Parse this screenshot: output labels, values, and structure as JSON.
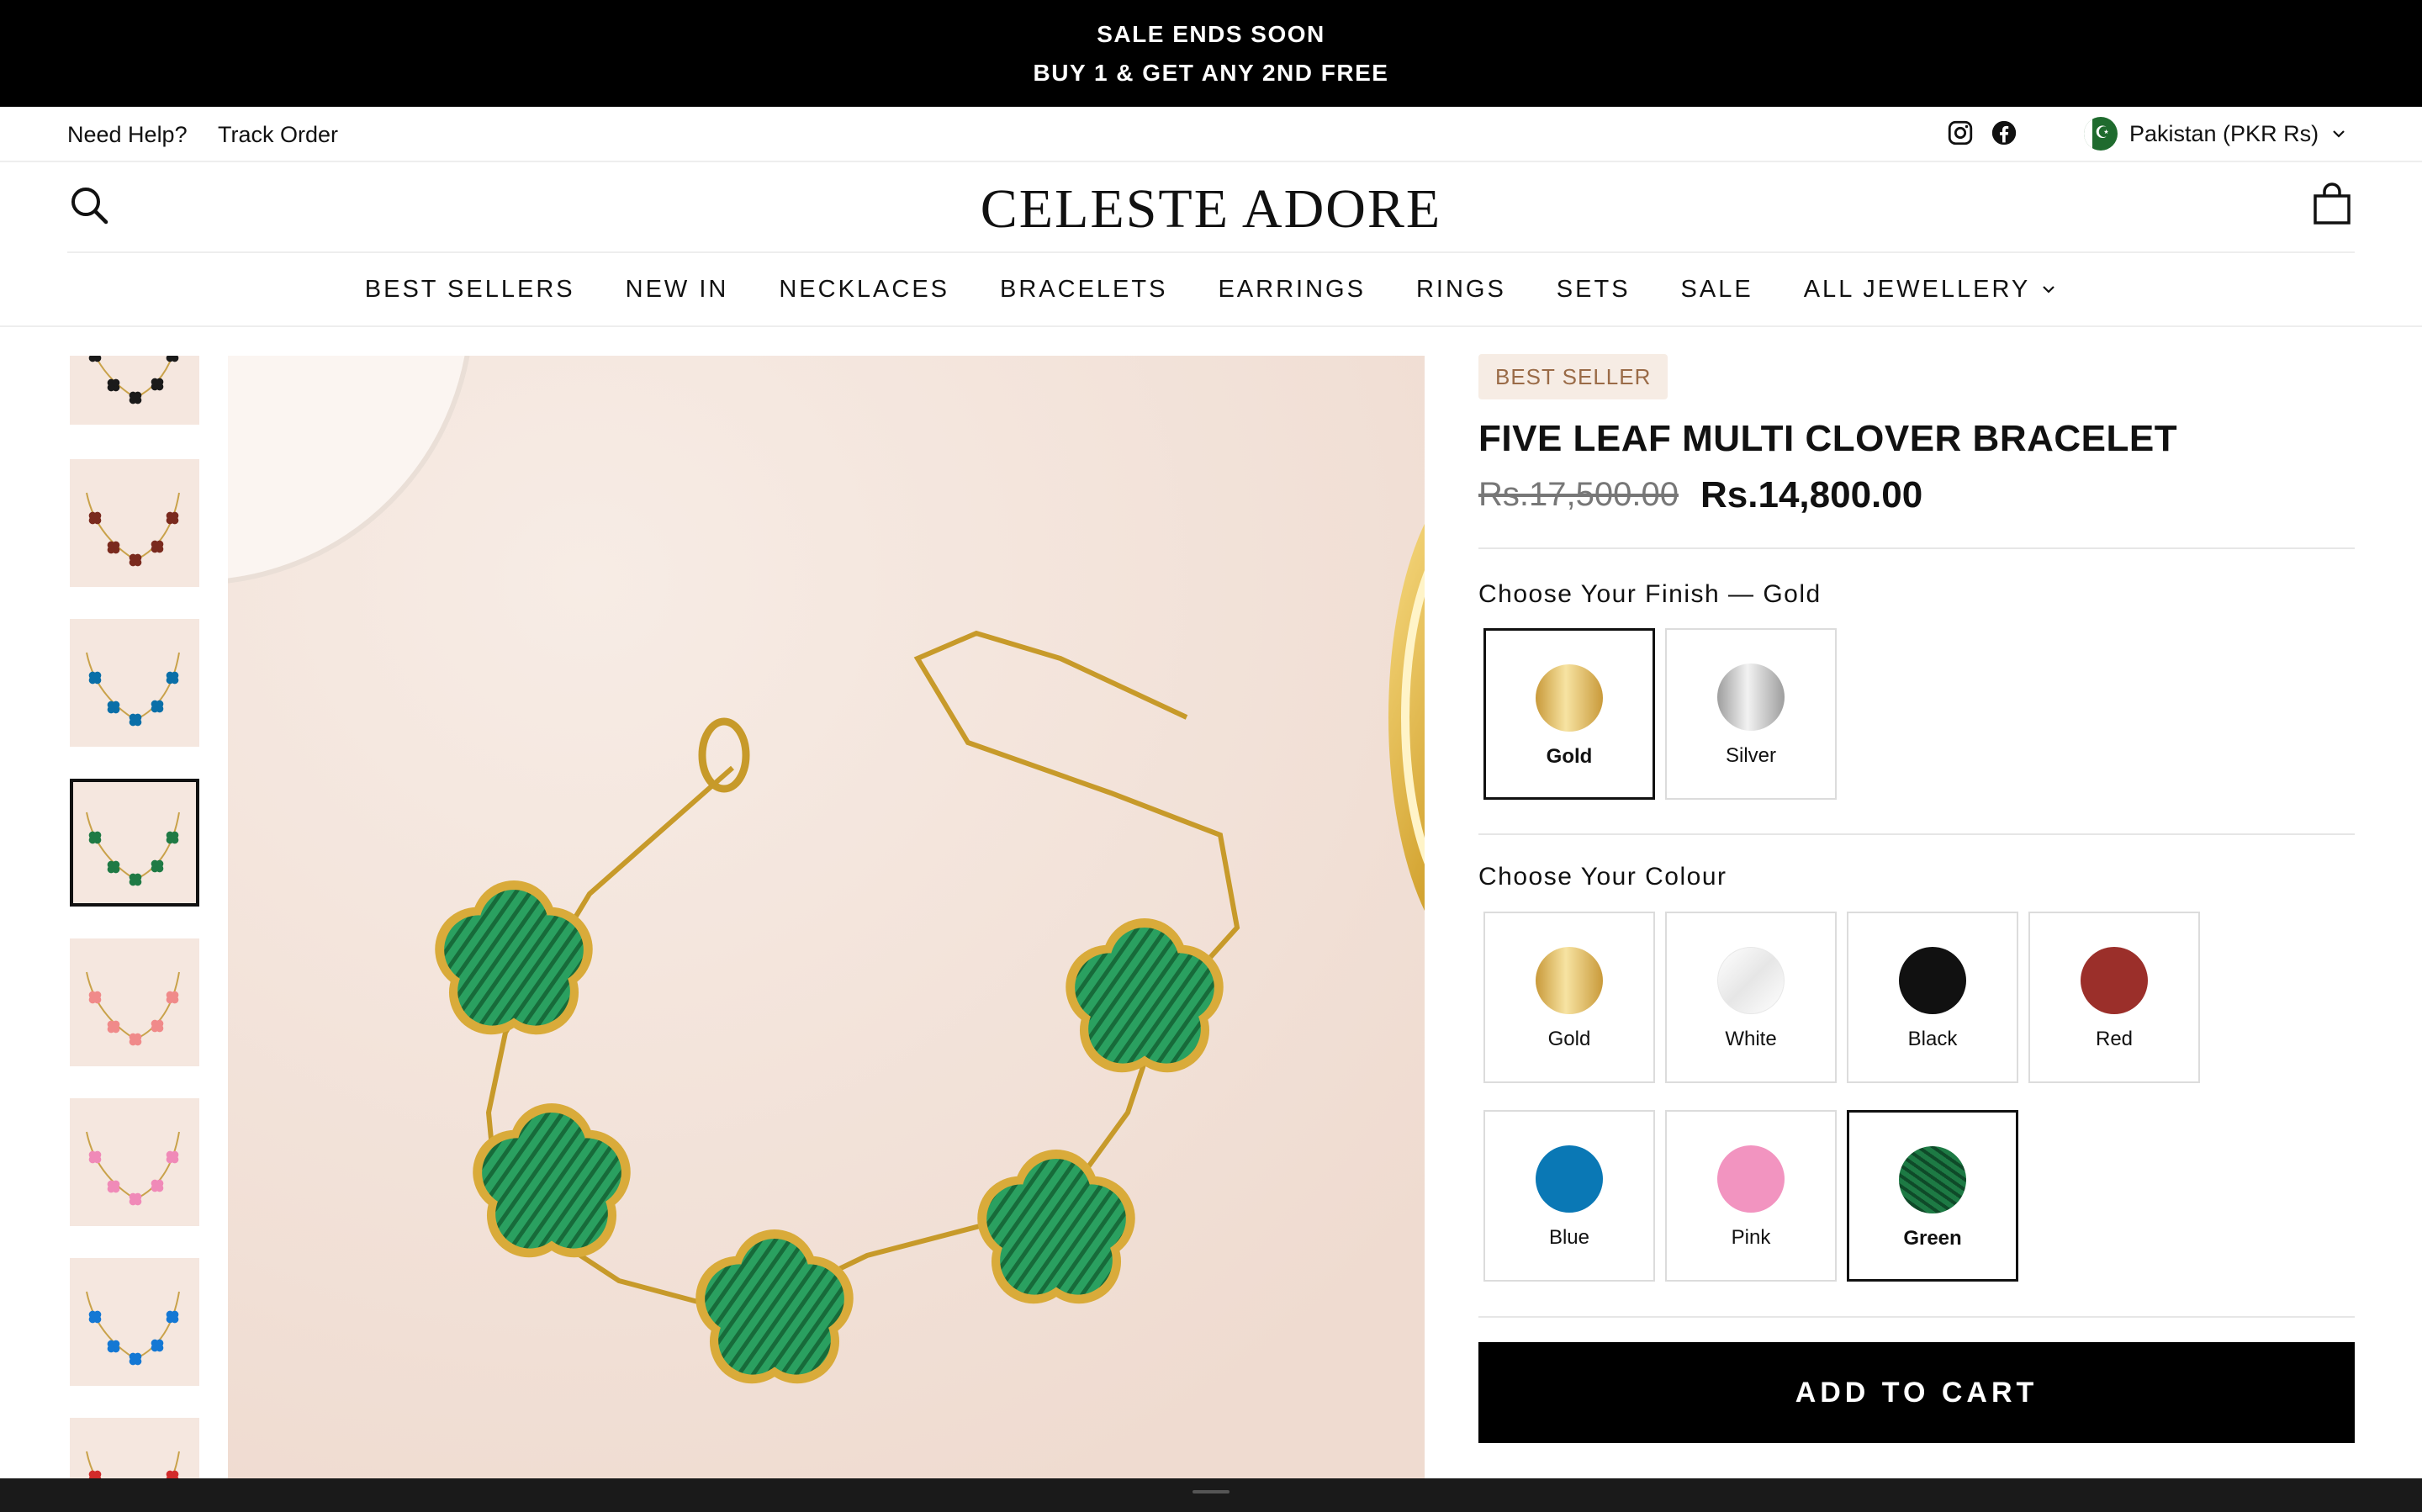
{
  "announcement": {
    "line1": "SALE ENDS SOON",
    "line2": "BUY 1 & GET ANY 2ND FREE"
  },
  "utility": {
    "help_label": "Need Help?",
    "track_label": "Track Order",
    "social_icons": [
      "instagram-icon",
      "facebook-icon"
    ],
    "country_label": "Pakistan (PKR Rs)"
  },
  "header": {
    "logo": "CELESTE ADORE",
    "icons": [
      "search-icon",
      "cart-icon"
    ]
  },
  "nav": {
    "items": [
      "BEST SELLERS",
      "NEW IN",
      "NECKLACES",
      "BRACELETS",
      "EARRINGS",
      "RINGS",
      "SETS",
      "SALE",
      "ALL JEWELLERY"
    ]
  },
  "product": {
    "badge": "BEST SELLER",
    "title": "FIVE LEAF MULTI CLOVER BRACELET",
    "price_old": "Rs.17,500.00",
    "price_new": "Rs.14,800.00",
    "finish_label": "Choose Your Finish — Gold",
    "finishes": [
      {
        "name": "Gold",
        "color": "#d9b45a",
        "selected": true
      },
      {
        "name": "Silver",
        "color": "#c9c9c9",
        "selected": false
      }
    ],
    "colour_label": "Choose Your Colour",
    "colours": [
      {
        "name": "Gold",
        "color": "#d9b45a",
        "selected": false
      },
      {
        "name": "White",
        "color": "#f3f3f3",
        "selected": false
      },
      {
        "name": "Black",
        "color": "#111111",
        "selected": false
      },
      {
        "name": "Red",
        "color": "#9b2f2a",
        "selected": false
      },
      {
        "name": "Blue",
        "color": "#0a78b5",
        "selected": false
      },
      {
        "name": "Pink",
        "color": "#f294c0",
        "selected": false
      },
      {
        "name": "Green",
        "color": "#1f7a45",
        "selected": true
      }
    ],
    "add_to_cart": "ADD TO CART"
  },
  "gallery": {
    "thumb_colors": [
      "#1a1a1a",
      "#7a2a1e",
      "#0a6fa8",
      "#1f7a45",
      "#f08a8a",
      "#f08ab8",
      "#1478d4",
      "#d22b2b"
    ],
    "selected_index": 3
  }
}
